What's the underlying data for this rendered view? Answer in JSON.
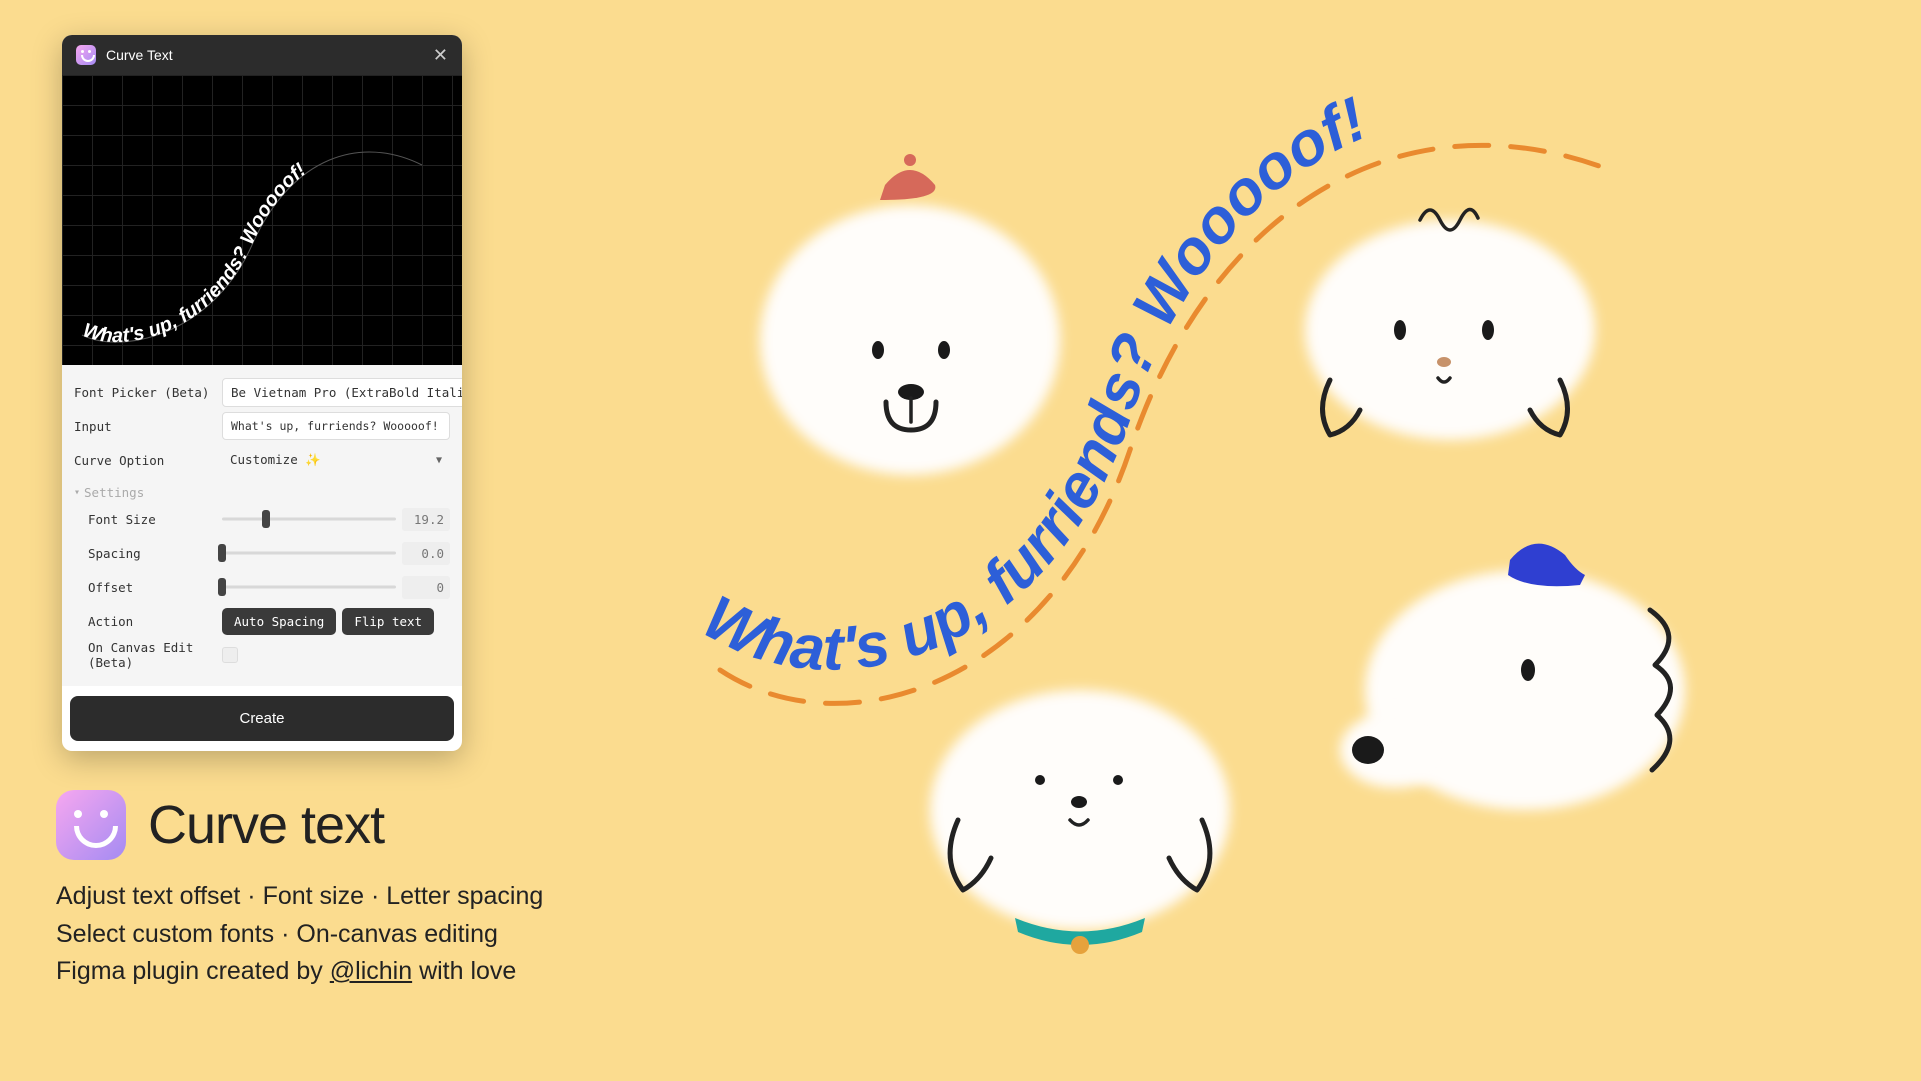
{
  "panel": {
    "title": "Curve Text",
    "preview_text": "What's up, furriends? Wooooof!",
    "fields": {
      "font_picker_label": "Font Picker (Beta)",
      "font_picker_value": "Be Vietnam Pro (ExtraBold Italic)",
      "input_label": "Input",
      "input_value": "What's up, furriends? Wooooof!",
      "curve_option_label": "Curve Option",
      "curve_option_value": "Customize ✨"
    },
    "settings": {
      "heading": "Settings",
      "font_size_label": "Font Size",
      "font_size_value": "19.2",
      "font_size_pct": 25,
      "spacing_label": "Spacing",
      "spacing_value": "0.0",
      "spacing_pct": 0,
      "offset_label": "Offset",
      "offset_value": "0",
      "offset_pct": 0,
      "action_label": "Action",
      "auto_spacing_btn": "Auto Spacing",
      "flip_text_btn": "Flip text",
      "on_canvas_label": "On Canvas Edit (Beta)"
    },
    "create_btn": "Create"
  },
  "promo": {
    "title": "Curve text",
    "line1": "Adjust text offset · Font size · Letter spacing",
    "line2": "Select custom fonts · On-canvas editing",
    "line3_prefix": "Figma plugin created by ",
    "line3_link": "@lichin",
    "line3_suffix": " with love"
  },
  "illustration": {
    "curve_text": "What's up, furriends? Wooooof!"
  },
  "colors": {
    "bg": "#fbdc8f",
    "accent": "#2d5fd8",
    "dash": "#e98a2f"
  }
}
